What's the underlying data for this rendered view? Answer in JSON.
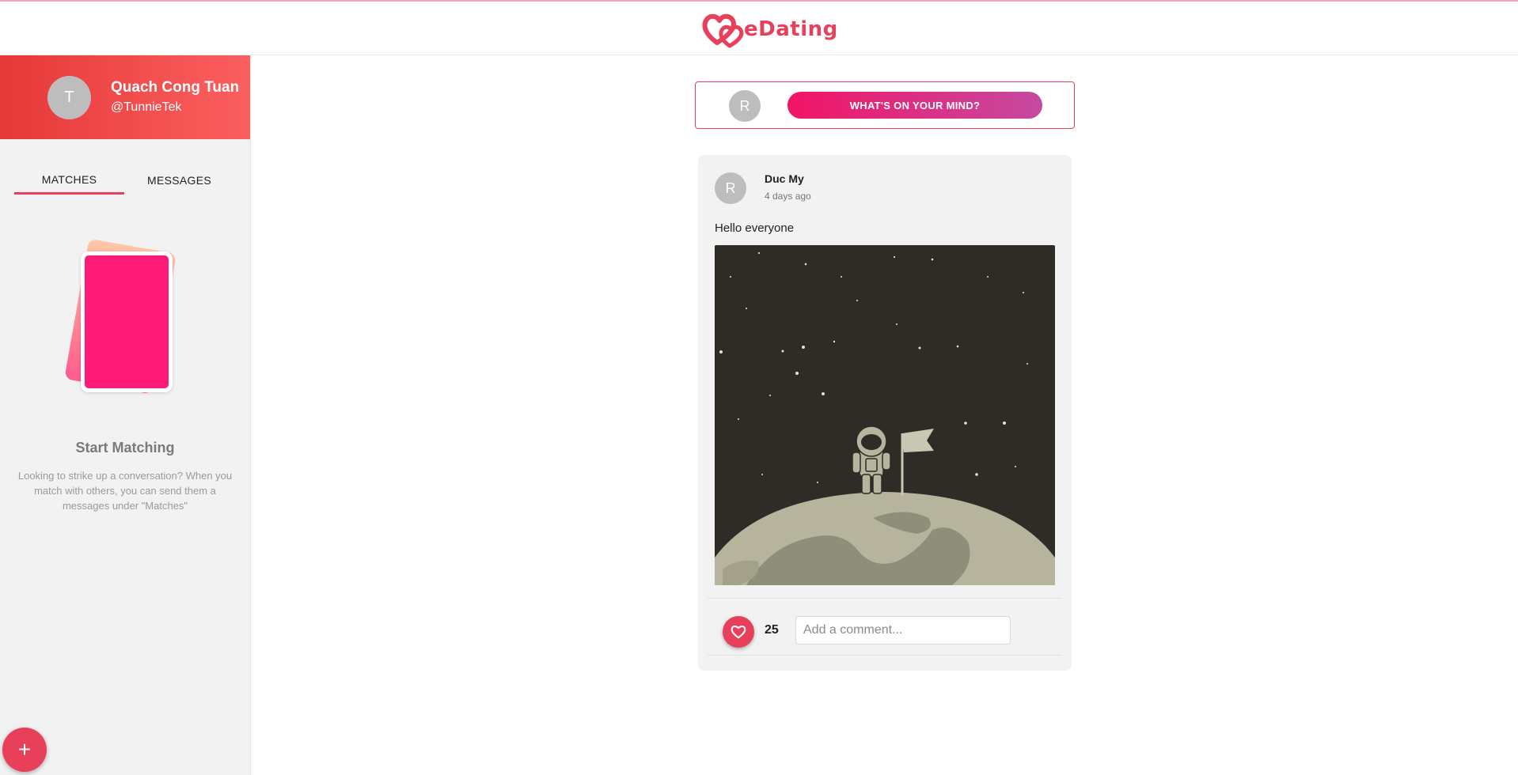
{
  "app": {
    "brand_text": "eDating",
    "brand_color": "#e8405a",
    "logo_icon": "double-heart-icon"
  },
  "profile": {
    "initial": "T",
    "name": "Quach Cong Tuan",
    "handle": "@TunnieTek"
  },
  "tabs": [
    {
      "label": "MATCHES",
      "active": true
    },
    {
      "label": "MESSAGES",
      "active": false
    }
  ],
  "empty_state": {
    "title": "Start Matching",
    "description": "Looking to strike up a conversation? When you match with others, you can send them a messages under \"Matches\""
  },
  "fab": {
    "label": "+"
  },
  "composer": {
    "avatar_initial": "R",
    "button_label": "WHAT'S ON YOUR MIND?"
  },
  "post": {
    "avatar_initial": "R",
    "author": "Duc My",
    "time": "4 days ago",
    "text": "Hello everyone",
    "image_icon": "astronaut-on-moon-illustration",
    "likes": "25",
    "comment_placeholder": "Add a comment..."
  }
}
